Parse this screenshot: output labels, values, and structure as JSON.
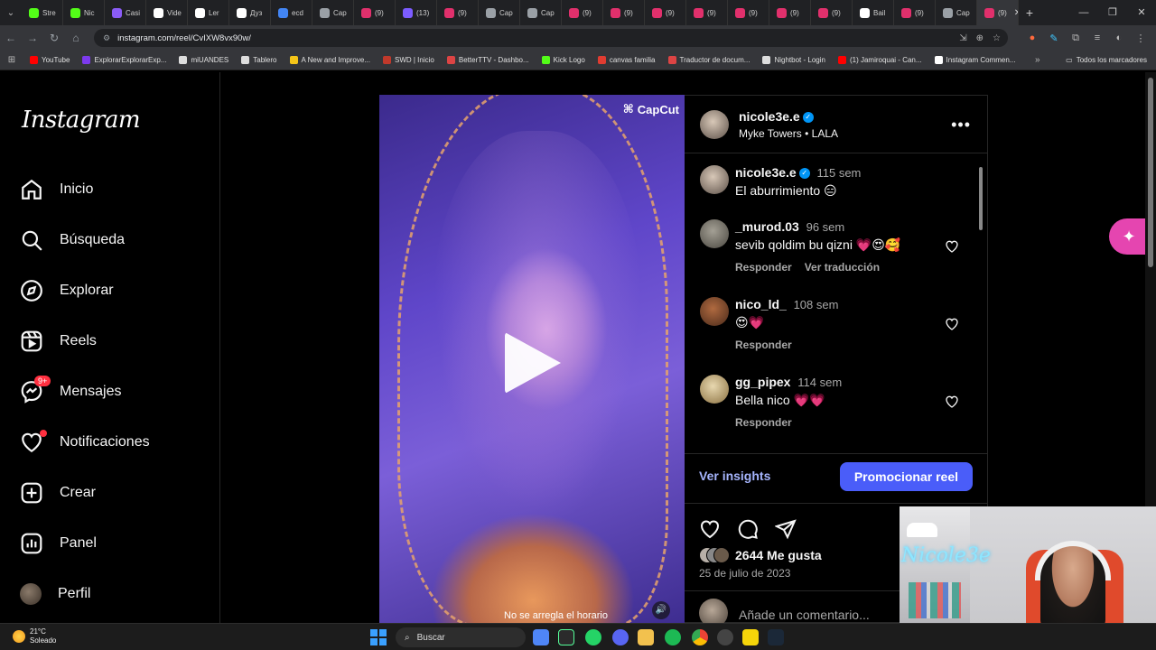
{
  "browser": {
    "tabs": [
      {
        "label": "Stre",
        "color": "#53fc18"
      },
      {
        "label": "Nic",
        "color": "#53fc18"
      },
      {
        "label": "Casi",
        "color": "#8b5cf6"
      },
      {
        "label": "Vide",
        "color": "#ffffff"
      },
      {
        "label": "Ler",
        "color": "#ffffff"
      },
      {
        "label": "Дуз",
        "color": "#ffffff"
      },
      {
        "label": "ecd",
        "color": "#4285f4"
      },
      {
        "label": "Cap",
        "color": "#9aa0a6"
      },
      {
        "label": "(9)",
        "color": "#e1306c"
      },
      {
        "label": "(13)",
        "color": "#7c5cff"
      },
      {
        "label": "(9)",
        "color": "#e1306c"
      },
      {
        "label": "Cap",
        "color": "#9aa0a6"
      },
      {
        "label": "Cap",
        "color": "#9aa0a6"
      },
      {
        "label": "(9)",
        "color": "#e1306c"
      },
      {
        "label": "(9)",
        "color": "#e1306c"
      },
      {
        "label": "(9)",
        "color": "#e1306c"
      },
      {
        "label": "(9)",
        "color": "#e1306c"
      },
      {
        "label": "(9)",
        "color": "#e1306c"
      },
      {
        "label": "(9)",
        "color": "#e1306c"
      },
      {
        "label": "(9)",
        "color": "#e1306c"
      },
      {
        "label": "Bail",
        "color": "#ffffff"
      },
      {
        "label": "(9)",
        "color": "#e1306c"
      },
      {
        "label": "Cap",
        "color": "#9aa0a6"
      },
      {
        "label": "(9)",
        "color": "#e1306c"
      }
    ],
    "url": "instagram.com/reel/CvIXW8vx90w/",
    "bookmarks": [
      {
        "label": "YouTube",
        "color": "#ff0000"
      },
      {
        "label": "ExplorarExplorarExp...",
        "color": "#7c3aed"
      },
      {
        "label": "miUANDES",
        "color": "#dddddd"
      },
      {
        "label": "Tablero",
        "color": "#dddddd"
      },
      {
        "label": "A New and Improve...",
        "color": "#f5c518"
      },
      {
        "label": "SWD | Inicio",
        "color": "#c0392b"
      },
      {
        "label": "BetterTTV - Dashbo...",
        "color": "#d44"
      },
      {
        "label": "Kick Logo",
        "color": "#53fc18"
      },
      {
        "label": "canvas familia",
        "color": "#e03c31"
      },
      {
        "label": "Traductor de docum...",
        "color": "#d44"
      },
      {
        "label": "Nightbot - Login",
        "color": "#dddddd"
      },
      {
        "label": "(1) Jamiroquai - Can...",
        "color": "#ff0000"
      },
      {
        "label": "Instagram Commen...",
        "color": "#ffffff"
      }
    ],
    "bookmarks_folder": "Todos los marcadores"
  },
  "sidebar": {
    "logo": "Instagram",
    "items": [
      {
        "label": "Inicio",
        "icon": "home-icon"
      },
      {
        "label": "Búsqueda",
        "icon": "search-icon"
      },
      {
        "label": "Explorar",
        "icon": "compass-icon"
      },
      {
        "label": "Reels",
        "icon": "reels-icon"
      },
      {
        "label": "Mensajes",
        "icon": "messenger-icon",
        "badge": "9+"
      },
      {
        "label": "Notificaciones",
        "icon": "heart-icon"
      },
      {
        "label": "Crear",
        "icon": "plus-square-icon"
      },
      {
        "label": "Panel",
        "icon": "dashboard-icon"
      },
      {
        "label": "Perfil",
        "icon": "avatar"
      }
    ]
  },
  "post": {
    "video_watermark": "CapCut",
    "video_caption": "No se arregla el horario",
    "author": "nicole3e.e",
    "audio": "Myke Towers • LALA",
    "caption": {
      "user": "nicole3e.e",
      "time": "115 sem",
      "text": "El aburrimiento 😑"
    },
    "comments": [
      {
        "user": "_murod.03",
        "time": "96 sem",
        "text": "sevib qoldim bu qizni 💗😍🥰",
        "actions": [
          "Responder",
          "Ver traducción"
        ]
      },
      {
        "user": "nico_ld_",
        "time": "108 sem",
        "text": "😍💗",
        "actions": [
          "Responder"
        ]
      },
      {
        "user": "gg_pipex",
        "time": "114 sem",
        "text": "Bella nico 💗💗",
        "actions": [
          "Responder"
        ]
      }
    ],
    "insights_label": "Ver insights",
    "promote_label": "Promocionar reel",
    "likes": "2644 Me gusta",
    "date": "25 de julio de 2023",
    "comment_placeholder": "Añade un comentario..."
  },
  "webcam": {
    "neon_sign": "Nicole3e"
  },
  "taskbar": {
    "temperature": "21°C",
    "weather": "Soleado",
    "search": "Buscar"
  }
}
